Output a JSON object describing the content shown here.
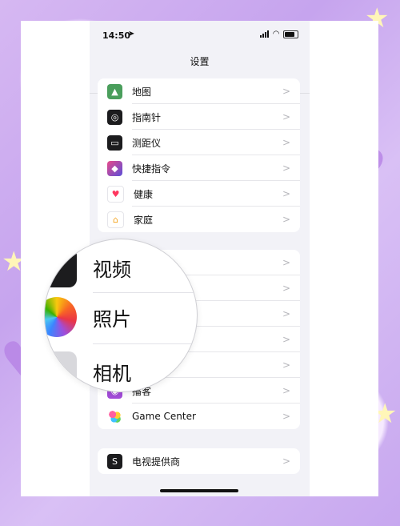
{
  "status": {
    "time": "14:50",
    "location_icon": "location-arrow-icon"
  },
  "nav": {
    "title": "设置"
  },
  "group1": [
    {
      "label": "地图",
      "icon": "maps-icon",
      "color": "#4a9e5c"
    },
    {
      "label": "指南针",
      "icon": "compass-icon",
      "color": "#1c1c1e"
    },
    {
      "label": "测距仪",
      "icon": "measure-icon",
      "color": "#1c1c1e"
    },
    {
      "label": "快捷指令",
      "icon": "shortcuts-icon",
      "color": "#5b4fd8"
    },
    {
      "label": "健康",
      "icon": "health-icon",
      "color": "#ffffff"
    },
    {
      "label": "家庭",
      "icon": "home-icon",
      "color": "#ffffff"
    }
  ],
  "group2_visible": [
    {
      "label": "播客",
      "icon": "podcasts-icon",
      "color": "#a24bd8"
    },
    {
      "label": "Game Center",
      "icon": "game-center-icon",
      "color": "#ffffff"
    }
  ],
  "magnified": {
    "row1": "视频",
    "row2": "照片",
    "row3": "相机"
  },
  "group3": [
    {
      "label": "电视提供商",
      "icon": "tv-provider-icon",
      "color": "#1c1c1e"
    }
  ]
}
